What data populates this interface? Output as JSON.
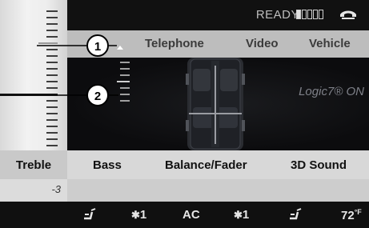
{
  "status": {
    "ready_text": "READY",
    "signal_bars": 5
  },
  "top_menu": {
    "items": [
      "Telephone",
      "Video",
      "Vehicle"
    ]
  },
  "treble": {
    "label": "Treble",
    "value": "-3"
  },
  "main": {
    "logic_status": "Logic7® ON"
  },
  "bottom_menu": {
    "items": [
      "Bass",
      "Balance/Fader",
      "3D Sound"
    ]
  },
  "climate": {
    "left_fan": "1",
    "ac_label": "AC",
    "right_fan": "1",
    "temperature": "72",
    "temp_unit": "°F"
  },
  "callouts": [
    "1",
    "2"
  ],
  "icons": [
    "phone-icon",
    "signal-bars-icon",
    "car-top-view-icon",
    "seat-vent-icon",
    "fan-icon",
    "menu-marker-icon"
  ]
}
